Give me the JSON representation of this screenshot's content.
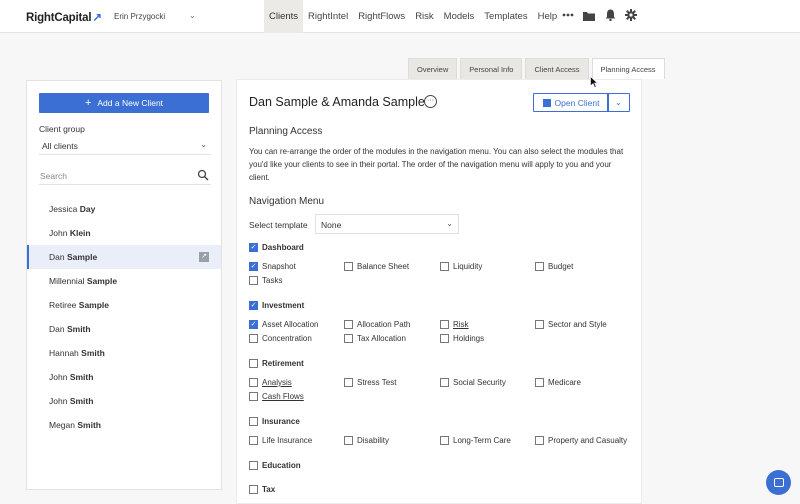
{
  "brand": {
    "logo_text": "RightCapital",
    "logo_arrow": "↗",
    "accent": "#3b6fd4"
  },
  "user": {
    "name": "Erin Przygocki"
  },
  "nav": {
    "items": [
      "Clients",
      "RightIntel",
      "RightFlows",
      "Risk",
      "Models",
      "Templates",
      "Help"
    ],
    "active": "Clients",
    "more_icon": "ellipsis-icon",
    "icons": [
      "folder-icon",
      "bell-icon",
      "gear-icon"
    ]
  },
  "sidebar": {
    "add_button": "Add a New Client",
    "client_group_label": "Client group",
    "client_group_value": "All clients",
    "search_placeholder": "Search",
    "clients": [
      {
        "first": "Jessica",
        "last": "Day"
      },
      {
        "first": "John",
        "last": "Klein"
      },
      {
        "first": "Dan",
        "last": "Sample",
        "selected": true
      },
      {
        "first": "Millennial",
        "last": "Sample"
      },
      {
        "first": "Retiree",
        "last": "Sample"
      },
      {
        "first": "Dan",
        "last": "Smith"
      },
      {
        "first": "Hannah",
        "last": "Smith"
      },
      {
        "first": "John",
        "last": "Smith"
      },
      {
        "first": "John",
        "last": "Smith"
      },
      {
        "first": "Megan",
        "last": "Smith"
      }
    ]
  },
  "tabs": [
    "Overview",
    "Personal Info",
    "Client Access",
    "Planning Access"
  ],
  "active_tab": "Planning Access",
  "main": {
    "client_name": "Dan Sample & Amanda Sample",
    "open_client": "Open Client",
    "planning_access_title": "Planning Access",
    "description": "You can re-arrange the order of the modules in the navigation menu. You can also select the modules that you'd like your clients to see in their portal. The order of the navigation menu will apply to you and your client.",
    "navigation_menu_title": "Navigation Menu",
    "select_template_label": "Select template",
    "select_template_value": "None",
    "groups": [
      {
        "name": "Dashboard",
        "checked": true,
        "items": [
          {
            "label": "Snapshot",
            "checked": true
          },
          {
            "label": "Balance Sheet",
            "checked": false
          },
          {
            "label": "Liquidity",
            "checked": false
          },
          {
            "label": "Budget",
            "checked": false
          },
          {
            "label": "Tasks",
            "checked": false
          }
        ]
      },
      {
        "name": "Investment",
        "checked": true,
        "items": [
          {
            "label": "Asset Allocation",
            "checked": true
          },
          {
            "label": "Allocation Path",
            "checked": false
          },
          {
            "label": "Risk",
            "checked": false,
            "underline": true
          },
          {
            "label": "Sector and Style",
            "checked": false
          },
          {
            "label": "Concentration",
            "checked": false
          },
          {
            "label": "Tax Allocation",
            "checked": false
          },
          {
            "label": "Holdings",
            "checked": false
          }
        ]
      },
      {
        "name": "Retirement",
        "checked": false,
        "items": [
          {
            "label": "Analysis",
            "checked": false,
            "underline": true
          },
          {
            "label": "Stress Test",
            "checked": false
          },
          {
            "label": "Social Security",
            "checked": false
          },
          {
            "label": "Medicare",
            "checked": false
          },
          {
            "label": "Cash Flows",
            "checked": false,
            "underline": true
          }
        ]
      },
      {
        "name": "Insurance",
        "checked": false,
        "items": [
          {
            "label": "Life Insurance",
            "checked": false
          },
          {
            "label": "Disability",
            "checked": false
          },
          {
            "label": "Long-Term Care",
            "checked": false
          },
          {
            "label": "Property and Casualty",
            "checked": false
          }
        ]
      },
      {
        "name": "Education",
        "checked": false,
        "items": []
      },
      {
        "name": "Tax",
        "checked": false,
        "items": []
      }
    ]
  }
}
